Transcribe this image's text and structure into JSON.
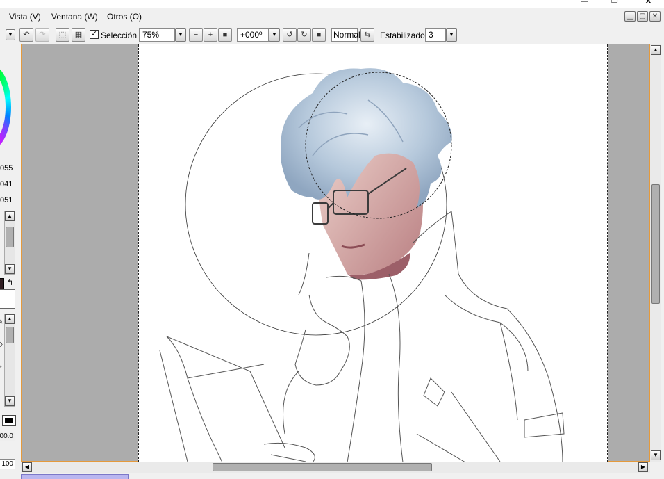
{
  "menubar": {
    "items": [
      {
        "label": "Vista (V)"
      },
      {
        "label": "Ventana (W)"
      },
      {
        "label": "Otros (O)"
      }
    ]
  },
  "toolbar": {
    "selection_label": "Selección",
    "selection_checked": true,
    "zoom": "75%",
    "rotation": "+000º",
    "blend_mode": "Normal",
    "stabilizer_label": "Estabilizador",
    "stabilizer_value": "3"
  },
  "left_panel": {
    "values": [
      "055",
      "041",
      "051"
    ],
    "opacity_value": "00.0",
    "brush_size": "100"
  },
  "icons": [
    "undo-icon",
    "redo-icon",
    "deselect-icon",
    "invert-selection-icon",
    "zoom-out-icon",
    "zoom-in-icon",
    "reset-zoom-icon",
    "rotate-ccw-icon",
    "rotate-cw-icon",
    "reset-rotation-icon",
    "flip-horizontal-icon",
    "swap-colors-icon"
  ],
  "colors": {
    "canvas_bg": "#acacac",
    "paper": "#ffffff",
    "canvas_border": "#e59a3c",
    "hair": "#b6c9db",
    "skin": "#dcb4ad"
  }
}
